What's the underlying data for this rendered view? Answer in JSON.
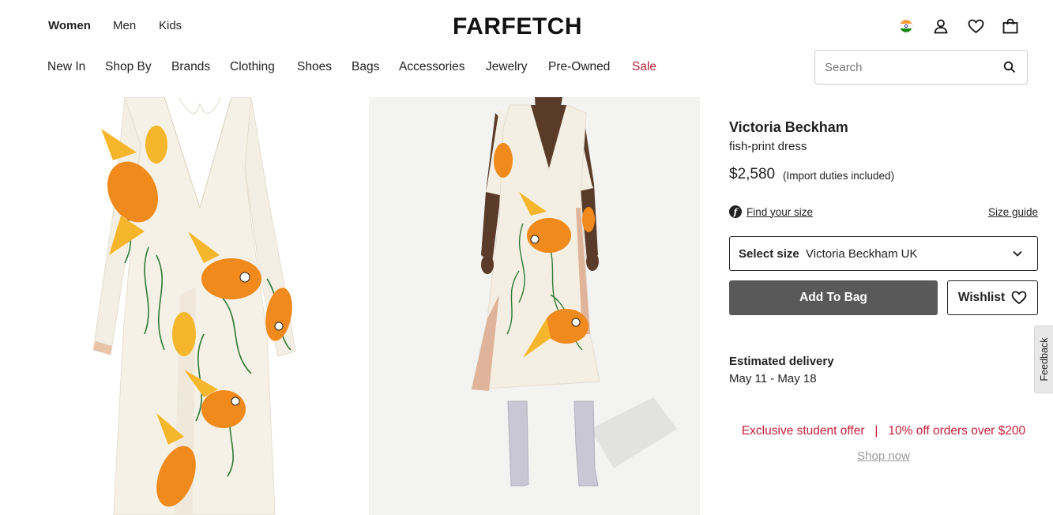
{
  "header": {
    "genders": [
      "Women",
      "Men",
      "Kids"
    ],
    "active_gender": "Women",
    "logo": "FARFETCH",
    "icons": [
      "india-flag-icon",
      "account-icon",
      "heart-icon",
      "shopping-bag-icon"
    ]
  },
  "nav": {
    "items": [
      "New In",
      "Shop By",
      "Brands",
      "Clothing",
      "Shoes",
      "Bags",
      "Accessories",
      "Jewelry",
      "Pre-Owned",
      "Sale"
    ],
    "sale_color": "#b8213b"
  },
  "search": {
    "placeholder": "Search",
    "icon": "search-icon"
  },
  "product": {
    "brand": "Victoria Beckham",
    "name": "fish-print dress",
    "price": "$2,580",
    "duties_note": "(Import duties included)",
    "find_size": "Find your size",
    "size_guide": "Size guide",
    "select_size_label": "Select size",
    "select_size_value": "Victoria Beckham UK",
    "add_to_bag": "Add To Bag",
    "wishlist": "Wishlist"
  },
  "delivery": {
    "title": "Estimated delivery",
    "dates": "May 11 - May 18"
  },
  "promo": {
    "text": "Exclusive student offer   |   10% off orders over $200",
    "link": "Shop now",
    "color": "#c4203a"
  },
  "feedback": "Feedback",
  "colors": {
    "accent_button": "#595959",
    "text": "#222222"
  }
}
